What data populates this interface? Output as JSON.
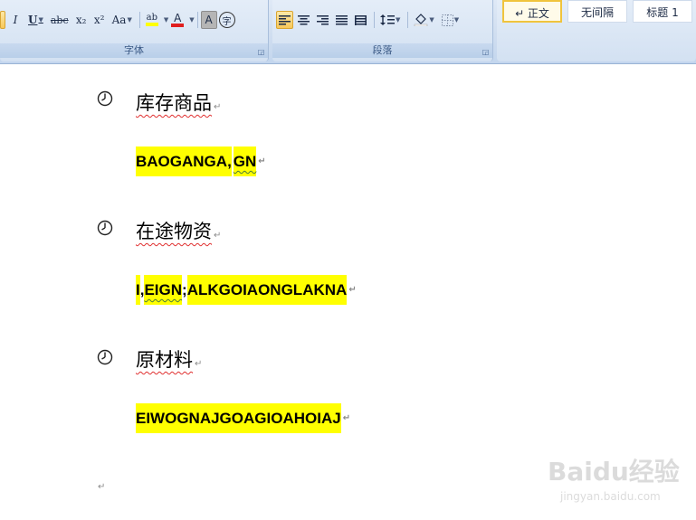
{
  "ribbon": {
    "font_group": {
      "label": "字体",
      "buttons": {
        "italic": "I",
        "underline": "U",
        "strikethrough": "abc",
        "subscript": "x₂",
        "superscript": "x²",
        "change_case": "Aa",
        "highlight": "ab",
        "font_color": "A",
        "char_shading": "A",
        "enclose_char": "字"
      }
    },
    "paragraph_group": {
      "label": "段落"
    },
    "styles": {
      "normal": "↵ 正文",
      "no_spacing": "无间隔",
      "heading1": "标题 1"
    }
  },
  "document": {
    "items": [
      {
        "heading": "库存商品",
        "content": [
          "BAOGANGA",
          ",",
          "GN"
        ]
      },
      {
        "heading": "在途物资",
        "content": [
          "I",
          ",",
          "EIGN",
          ";",
          "ALKGOIAONGLAKNA"
        ]
      },
      {
        "heading": "原材料",
        "content": [
          "EIWOGNAJGOAGIOAHOIAJ"
        ]
      }
    ],
    "paragraph_mark": "↵"
  },
  "watermark": {
    "brand": "Baidu经验",
    "url": "jingyan.baidu.com"
  },
  "colors": {
    "highlight": "#ffff00",
    "ribbon": "#d0def0",
    "active_button": "#f7c85a"
  }
}
